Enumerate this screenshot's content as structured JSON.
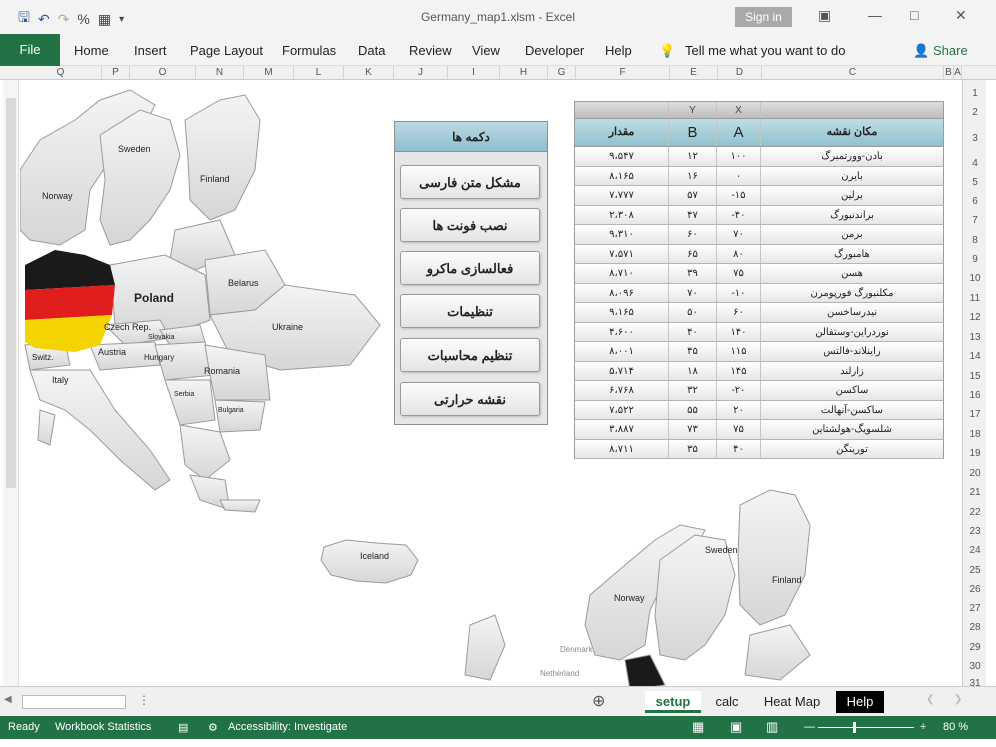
{
  "window": {
    "title": "Germany_map1.xlsm  -  Excel",
    "sign_in": "Sign in"
  },
  "ribbon": {
    "file": "File",
    "tabs": [
      "Home",
      "Insert",
      "Page Layout",
      "Formulas",
      "Data",
      "Review",
      "View",
      "Developer",
      "Help"
    ],
    "tell_me": "Tell me what you want to do",
    "share": "Share"
  },
  "columns": [
    "Q",
    "P",
    "O",
    "N",
    "M",
    "L",
    "K",
    "J",
    "I",
    "H",
    "G",
    "F",
    "E",
    "D",
    "C",
    "B",
    "A"
  ],
  "rows": [
    "1",
    "2",
    "3",
    "4",
    "5",
    "6",
    "7",
    "8",
    "9",
    "10",
    "11",
    "12",
    "13",
    "14",
    "15",
    "16",
    "17",
    "18",
    "19",
    "20",
    "21",
    "22",
    "23",
    "24",
    "25",
    "26",
    "27",
    "28",
    "29",
    "30",
    "31"
  ],
  "buttons_panel": {
    "header": "دکمه ها",
    "items": [
      "مشکل متن فارسی",
      "نصب فونت ها",
      "فعالسازی ماکرو",
      "تنظیمات",
      "تنظیم محاسبات",
      "نقشه حرارتی"
    ]
  },
  "table": {
    "top_headers": {
      "y": "Y",
      "x": "X"
    },
    "headers": {
      "value": "مقدار",
      "b": "B",
      "a": "A",
      "location": "مکان نقشه"
    },
    "rows": [
      {
        "value": "۹،۵۴۷",
        "b": "۱۲",
        "a": "۱۰۰",
        "location": "بادن-وورتمبرگ"
      },
      {
        "value": "۸،۱۶۵",
        "b": "۱۶",
        "a": "۰",
        "location": "بایرن"
      },
      {
        "value": "۷،۷۷۷",
        "b": "۵۷",
        "a": "-۱۵",
        "location": "برلین"
      },
      {
        "value": "۲،۳۰۸",
        "b": "۴۷",
        "a": "-۴۰",
        "location": "براندنبورگ"
      },
      {
        "value": "۹،۳۱۰",
        "b": "۶۰",
        "a": "۷۰",
        "location": "برمن"
      },
      {
        "value": "۷،۵۷۱",
        "b": "۶۵",
        "a": "۸۰",
        "location": "هامبورگ"
      },
      {
        "value": "۸،۷۱۰",
        "b": "۳۹",
        "a": "۷۵",
        "location": "هسن"
      },
      {
        "value": "۸،۰۹۶",
        "b": "۷۰",
        "a": "-۱۰",
        "location": "مکلنبورگ فورپومرن"
      },
      {
        "value": "۹،۱۶۵",
        "b": "۵۰",
        "a": "۶۰",
        "location": "نیدرساخسن"
      },
      {
        "value": "۴،۶۰۰",
        "b": "۴۰",
        "a": "۱۴۰",
        "location": "نوردراین-وستفالن"
      },
      {
        "value": "۸،۰۰۱",
        "b": "۴۵",
        "a": "۱۱۵",
        "location": "راینلاند-فالتس"
      },
      {
        "value": "۵،۷۱۴",
        "b": "۱۸",
        "a": "۱۴۵",
        "location": "زارلند"
      },
      {
        "value": "۶،۷۶۸",
        "b": "۳۲",
        "a": "-۲۰",
        "location": "ساکسن"
      },
      {
        "value": "۷،۵۲۲",
        "b": "۵۵",
        "a": "۲۰",
        "location": "ساکسن-آنهالت"
      },
      {
        "value": "۳،۸۸۷",
        "b": "۷۳",
        "a": "۷۵",
        "location": "شلسویگ-هولشتاین"
      },
      {
        "value": "۸،۷۱۱",
        "b": "۳۵",
        "a": "۴۰",
        "location": "تورینگن"
      }
    ]
  },
  "map_top": {
    "labels": [
      "Sweden",
      "Finland",
      "Norway",
      "Poland",
      "Belarus",
      "Ukraine",
      "Czech Rep.",
      "Slovakia",
      "Austria",
      "Hungary",
      "Switz.",
      "Italy",
      "Romania",
      "Serbia",
      "Bulgaria"
    ]
  },
  "map_bottom": {
    "labels": [
      "Iceland",
      "Sweden",
      "Finland",
      "Norway",
      "Denmark",
      "Netherland"
    ]
  },
  "sheet_tabs": [
    "setup",
    "calc",
    "Heat Map",
    "Help"
  ],
  "status": {
    "ready": "Ready",
    "workbook_stats": "Workbook Statistics",
    "accessibility": "Accessibility: Investigate",
    "zoom": "80 %"
  },
  "colors": {
    "excel_green": "#217346",
    "header_teal": "#8fc1cf"
  }
}
